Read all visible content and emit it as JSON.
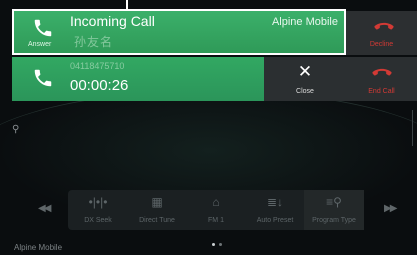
{
  "incoming_call": {
    "title": "Incoming Call",
    "provider": "Alpine Mobile",
    "answer_label": "Answer",
    "caller_name_blurred": "孙友名",
    "decline_label": "Decline"
  },
  "active_call": {
    "number_blurred": "04118475710",
    "timer": "00:00:26",
    "close_label": "Close",
    "end_call_label": "End Call"
  },
  "radio": {
    "functions": [
      {
        "icon": "dx-seek-icon",
        "label": "DX Seek"
      },
      {
        "icon": "direct-tune-icon",
        "label": "Direct Tune"
      },
      {
        "icon": "fm1-icon",
        "label": "FM 1"
      },
      {
        "icon": "auto-preset-icon",
        "label": "Auto Preset"
      },
      {
        "icon": "program-type-icon",
        "label": "Program Type"
      }
    ],
    "footer_source": "Alpine Mobile"
  },
  "colors": {
    "call_green": "#33a862",
    "decline_red": "#d23a35",
    "panel_dark": "#2b2f31"
  }
}
